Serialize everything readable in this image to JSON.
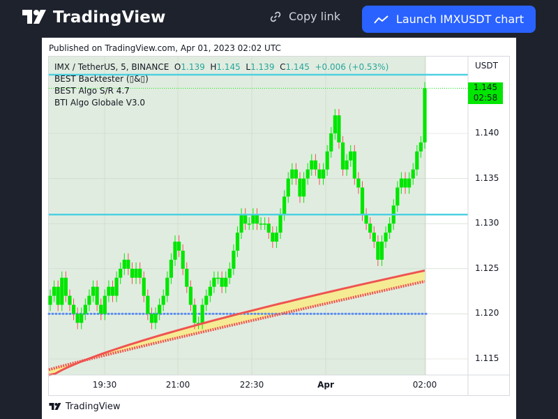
{
  "header": {
    "brand": "TradingView",
    "copy_link": "Copy link",
    "launch_button": "Launch IMXUSDT chart",
    "accent_color": "#2962ff"
  },
  "card": {
    "published": "Published on TradingView.com, Apr 01, 2023 02:02 UTC",
    "footer_brand": "TradingView"
  },
  "legend": {
    "symbol": "IMX / TetherUS, 5, BINANCE",
    "o_label": "O",
    "o_val": "1.139",
    "h_label": "H",
    "h_val": "1.145",
    "l_label": "L",
    "l_val": "1.139",
    "c_label": "C",
    "c_val": "1.145",
    "change": "+0.006 (+0.53%)",
    "indicators": [
      "BEST Backtester (▯&▯)",
      "BEST Algo S/R 4.7",
      "BTI Algo Globale V3.0"
    ]
  },
  "price_axis": {
    "currency": "USDT",
    "ticks": [
      "1.140",
      "1.135",
      "1.130",
      "1.125",
      "1.120",
      "1.115"
    ],
    "last_price": "1.145",
    "countdown": "02:58"
  },
  "time_axis": {
    "ticks": [
      "19:30",
      "21:00",
      "22:30",
      "Apr",
      "02:00"
    ]
  },
  "chart_data": {
    "type": "candlestick",
    "symbol": "IMX/USDT",
    "interval": "5",
    "exchange": "BINANCE",
    "ylim": [
      1.113,
      1.148
    ],
    "last": {
      "open": 1.139,
      "high": 1.145,
      "low": 1.139,
      "close": 1.145,
      "change": 0.006,
      "change_pct": 0.53
    },
    "levels": {
      "resistance": 1.1465,
      "support": 1.131,
      "dotted": 1.12
    },
    "colors": {
      "up": "#00e600",
      "down": "#ef5350",
      "level": "#4dd0e1",
      "band": "#f0e68c",
      "dotted": "#5b8def"
    },
    "closes": [
      1.122,
      1.123,
      1.121,
      1.124,
      1.122,
      1.121,
      1.12,
      1.119,
      1.12,
      1.121,
      1.122,
      1.123,
      1.121,
      1.12,
      1.122,
      1.123,
      1.122,
      1.124,
      1.125,
      1.126,
      1.125,
      1.124,
      1.125,
      1.124,
      1.122,
      1.12,
      1.119,
      1.12,
      1.121,
      1.122,
      1.124,
      1.126,
      1.128,
      1.127,
      1.125,
      1.123,
      1.121,
      1.119,
      1.119,
      1.121,
      1.122,
      1.123,
      1.124,
      1.124,
      1.123,
      1.124,
      1.125,
      1.127,
      1.129,
      1.131,
      1.13,
      1.13,
      1.131,
      1.13,
      1.13,
      1.13,
      1.129,
      1.128,
      1.129,
      1.131,
      1.133,
      1.135,
      1.136,
      1.135,
      1.133,
      1.135,
      1.136,
      1.137,
      1.136,
      1.135,
      1.136,
      1.138,
      1.14,
      1.142,
      1.139,
      1.136,
      1.137,
      1.138,
      1.135,
      1.134,
      1.131,
      1.13,
      1.129,
      1.128,
      1.126,
      1.128,
      1.129,
      1.13,
      1.132,
      1.134,
      1.135,
      1.134,
      1.135,
      1.136,
      1.138,
      1.139,
      1.145
    ]
  }
}
